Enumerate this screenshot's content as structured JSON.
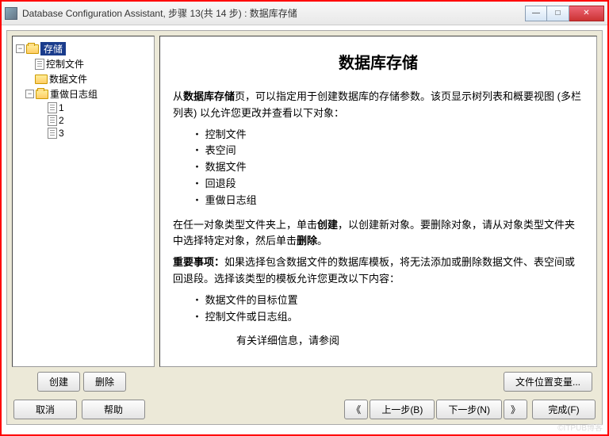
{
  "window": {
    "title": "Database Configuration Assistant, 步骤 13(共 14 步) : 数据库存储"
  },
  "tree": {
    "root": "存储",
    "items": [
      {
        "label": "控制文件",
        "icon": "doc"
      },
      {
        "label": "数据文件",
        "icon": "folder"
      },
      {
        "label": "重做日志组",
        "icon": "folder",
        "children": [
          {
            "label": "1",
            "icon": "doc"
          },
          {
            "label": "2",
            "icon": "doc"
          },
          {
            "label": "3",
            "icon": "doc"
          }
        ]
      }
    ]
  },
  "content": {
    "title": "数据库存储",
    "intro_prefix": "从",
    "intro_bold": "数据库存储",
    "intro_suffix": "页，可以指定用于创建数据库的存储参数。该页显示树列表和概要视图 (多栏列表) 以允许您更改并查看以下对象：",
    "list1": [
      "控制文件",
      "表空间",
      "数据文件",
      "回退段",
      "重做日志组"
    ],
    "para2_a": "在任一对象类型文件夹上，单击",
    "para2_b1": "创建",
    "para2_c": "，以创建新对象。要删除对象，请从对象类型文件夹中选择特定对象，然后单击",
    "para2_b2": "删除",
    "para2_d": "。",
    "important_label": "重要事项：",
    "important_text": "如果选择包含数据文件的数据库模板，将无法添加或删除数据文件、表空间或回退段。选择该类型的模板允许您更改以下内容：",
    "list2": [
      "数据文件的目标位置",
      "控制文件或日志组。"
    ],
    "more_info": "有关详细信息，请参阅"
  },
  "buttons": {
    "create": "创建",
    "delete": "删除",
    "file_loc": "文件位置变量...",
    "cancel": "取消",
    "help": "帮助",
    "back_arrow": "《",
    "back": "上一步(B)",
    "next": "下一步(N)",
    "next_arrow": "》",
    "finish": "完成(F)"
  },
  "watermark": "©ITPUB博客"
}
